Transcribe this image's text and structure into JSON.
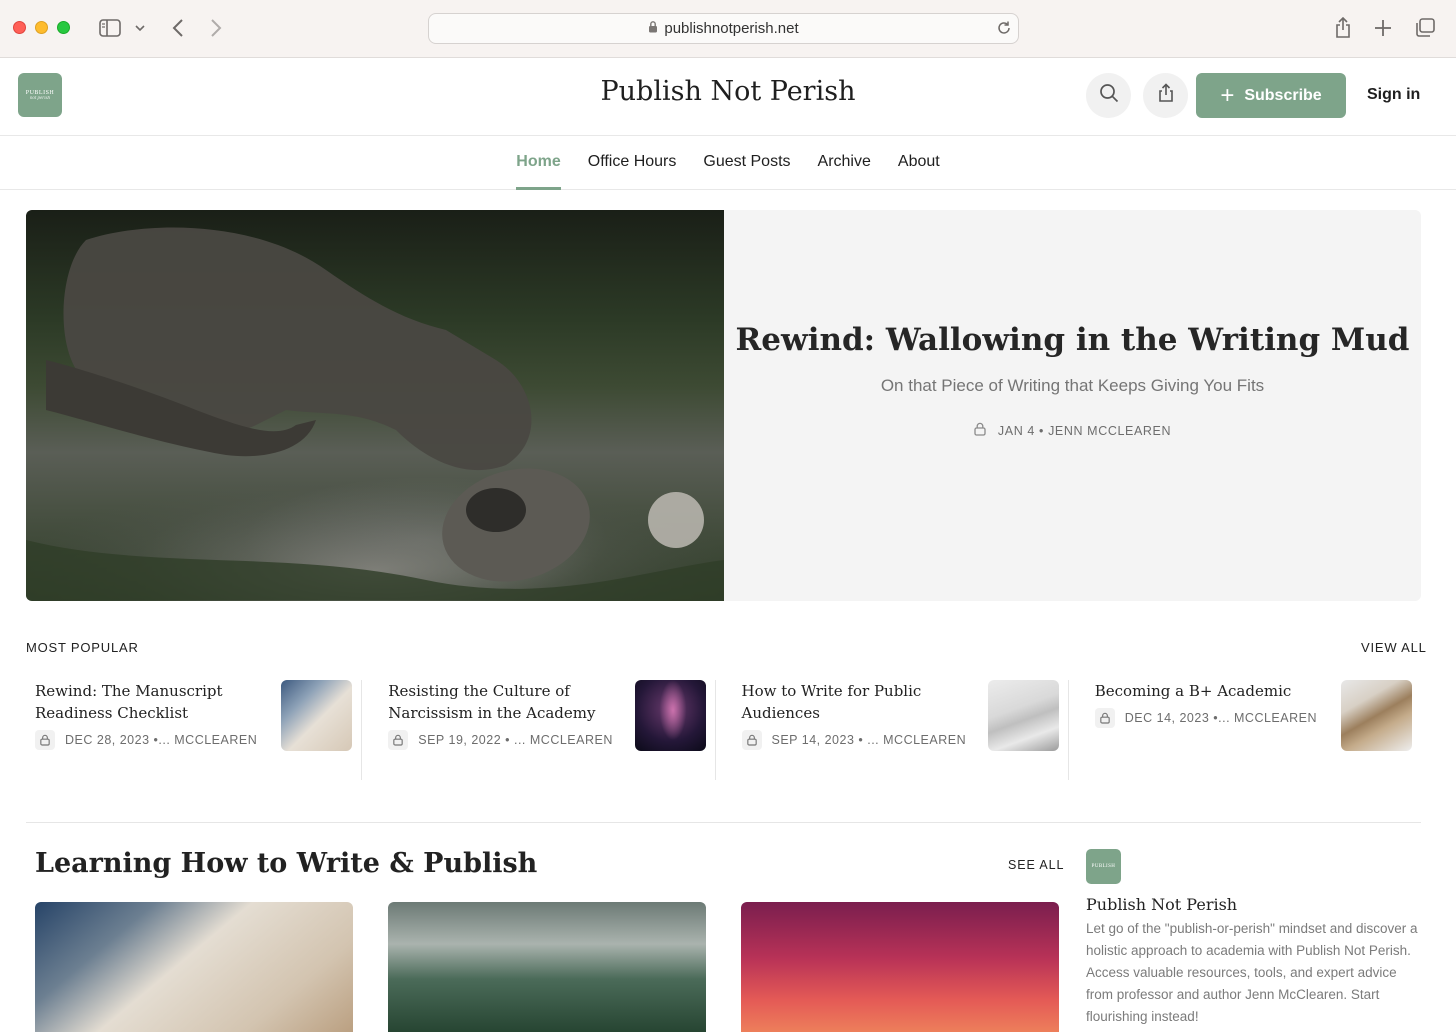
{
  "browser": {
    "url": "publishnotperish.net"
  },
  "header": {
    "logo_line1": "PUBLISH",
    "logo_line2": "not perish",
    "site_title": "Publish Not Perish",
    "subscribe_label": "Subscribe",
    "signin_label": "Sign in"
  },
  "nav": {
    "items": [
      {
        "label": "Home",
        "active": true
      },
      {
        "label": "Office Hours"
      },
      {
        "label": "Guest Posts"
      },
      {
        "label": "Archive"
      },
      {
        "label": "About"
      }
    ]
  },
  "hero": {
    "title": "Rewind: Wallowing in the Writing Mud",
    "subtitle": "On that Piece of Writing that Keeps Giving You Fits",
    "meta": "JAN 4 • JENN MCCLEAREN"
  },
  "most_popular": {
    "label": "MOST POPULAR",
    "view_all": "VIEW ALL",
    "items": [
      {
        "title": "Rewind: The Manuscript Readiness Checklist",
        "meta": "DEC 28, 2023 •... MCCLEAREN"
      },
      {
        "title": "Resisting the Culture of Narcissism in the Academy",
        "meta": "SEP 19, 2022 • ... MCCLEAREN"
      },
      {
        "title": "How to Write for Public Audiences",
        "meta": "SEP 14, 2023 • ... MCCLEAREN"
      },
      {
        "title": "Becoming a B+ Academic",
        "meta": "DEC 14, 2023 •... MCCLEAREN"
      }
    ]
  },
  "learning": {
    "heading": "Learning How to Write & Publish",
    "see_all": "SEE ALL"
  },
  "about": {
    "logo_text": "PUBLISH",
    "name": "Publish Not Perish",
    "description": "Let go of the \"publish-or-perish\" mindset and discover a holistic approach to academia with Publish Not Perish. Access valuable resources, tools, and expert advice from professor and author Jenn McClearen. Start flourishing instead!"
  },
  "colors": {
    "accent": "#7ea48a"
  }
}
